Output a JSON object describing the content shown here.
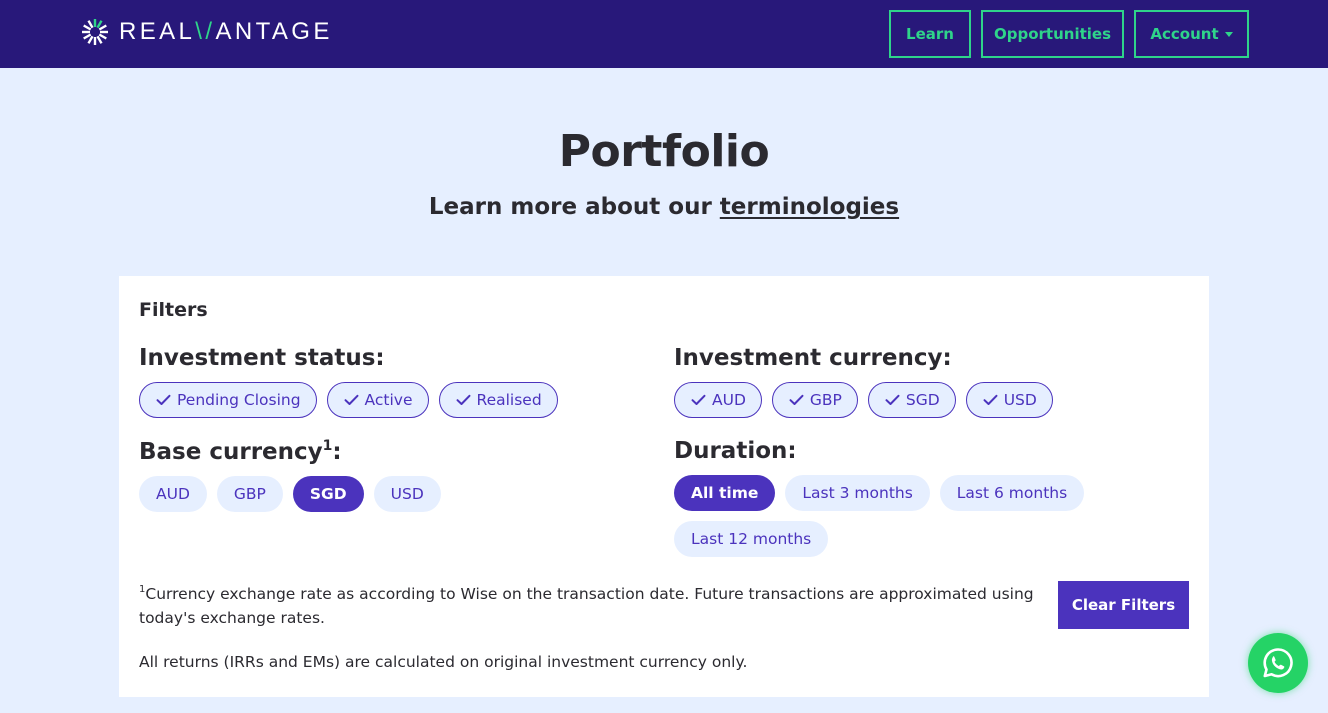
{
  "header": {
    "logo_text_a": "REAL",
    "logo_text_v": "\\/",
    "logo_text_b": "ANTAGE",
    "nav": {
      "learn": "Learn",
      "opportunities": "Opportunities",
      "account": "Account"
    },
    "colors": {
      "bar": "#28187a",
      "accent": "#2fd48a"
    }
  },
  "page": {
    "title": "Portfolio",
    "subtitle_prefix": "Learn more about our ",
    "subtitle_link": "terminologies"
  },
  "filters": {
    "title": "Filters",
    "investment_status": {
      "label": "Investment status:",
      "options": [
        {
          "label": "Pending Closing",
          "checked": true
        },
        {
          "label": "Active",
          "checked": true
        },
        {
          "label": "Realised",
          "checked": true
        }
      ]
    },
    "investment_currency": {
      "label": "Investment currency:",
      "options": [
        {
          "label": "AUD",
          "checked": true
        },
        {
          "label": "GBP",
          "checked": true
        },
        {
          "label": "SGD",
          "checked": true
        },
        {
          "label": "USD",
          "checked": true
        }
      ]
    },
    "base_currency": {
      "label": "Base currency",
      "footnote_marker": "1",
      "label_suffix": ":",
      "options": [
        "AUD",
        "GBP",
        "SGD",
        "USD"
      ],
      "selected": "SGD"
    },
    "duration": {
      "label": "Duration:",
      "options": [
        "All time",
        "Last 3 months",
        "Last 6 months",
        "Last 12 months"
      ],
      "selected": "All time"
    },
    "footnote_marker": "1",
    "footnote": "Currency exchange rate as according to Wise on the transaction date. Future transactions are approximated using today's exchange rates.",
    "returns_note": "All returns (IRRs and EMs) are calculated on original investment currency only.",
    "clear_label": "Clear Filters",
    "accent": "#4b33bd"
  },
  "widgets": {
    "chat_icon": "whatsapp-icon"
  }
}
